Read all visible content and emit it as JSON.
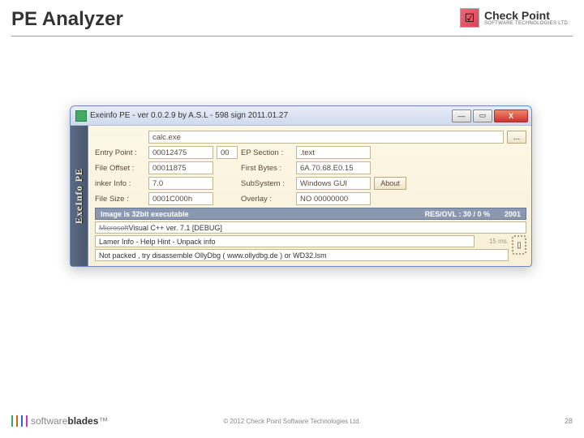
{
  "slide": {
    "title": "PE Analyzer",
    "logo": {
      "name": "Check Point",
      "sub": "SOFTWARE TECHNOLOGIES LTD."
    },
    "footer": {
      "brand_light": "software",
      "brand_bold": "blades",
      "copyright": "© 2012 Check Point Software Technologies Ltd.",
      "page": "28"
    }
  },
  "win": {
    "title": "Exeinfo PE - ver 0.0.2.9  by A.S.L -  598 sign 2011.01.27",
    "sidebar": "ExeInfo PE",
    "filename": "calc.exe",
    "browse_label": "...",
    "rows": [
      {
        "l1": "Entry Point :",
        "v1": "00012475",
        "extra": "00",
        "l2": "EP Section :",
        "v2": ".text"
      },
      {
        "l1": "File Offset :",
        "v1": "00011875",
        "extra": "",
        "l2": "First Bytes :",
        "v2": "6A.70.68.E0.15"
      },
      {
        "l1": "inker Info :",
        "v1": "7.0",
        "extra": "",
        "l2": "SubSystem :",
        "v2": "Windows GUI",
        "about": "About"
      },
      {
        "l1": "File Size :",
        "v1": "0001C000h",
        "extra": "",
        "l2": "Overlay :",
        "v2": "NO  00000000"
      }
    ],
    "status": {
      "left": "Image is 32bit executable",
      "mid": "RES/OVL : 30 / 0 %",
      "right": "2001"
    },
    "info1_strike": "Microsoft",
    "info1_rest": " Visual C++ ver. 7.1 [DEBUG]",
    "timing": "15 ms.",
    "info2": "Lamer Info - Help Hint - Unpack info",
    "info3": "Not packed , try disassemble OllyDbg ( www.ollydbg.de ) or  WD32.lsm"
  }
}
